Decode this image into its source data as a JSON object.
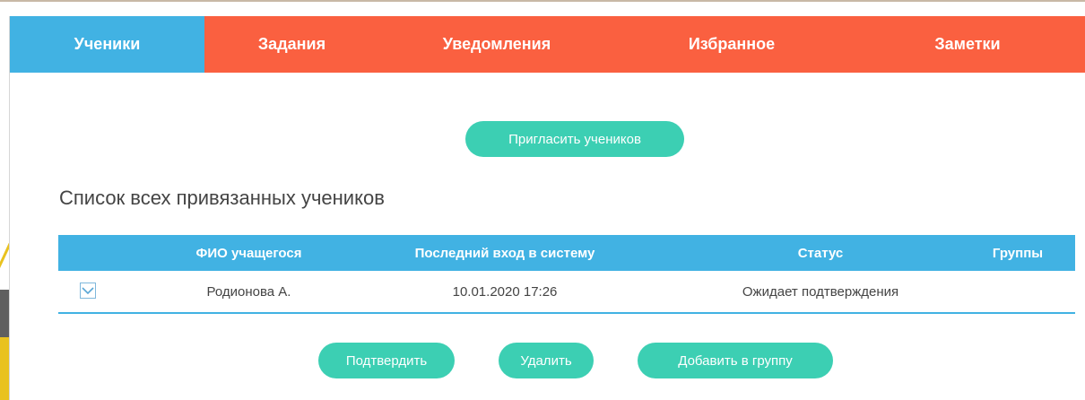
{
  "tabs": [
    {
      "label": "Ученики",
      "active": true
    },
    {
      "label": "Задания",
      "active": false
    },
    {
      "label": "Уведомления",
      "active": false
    },
    {
      "label": "Избранное",
      "active": false
    },
    {
      "label": "Заметки",
      "active": false
    }
  ],
  "invite_button": "Пригласить учеников",
  "section_title": "Список всех привязанных учеников",
  "table": {
    "headers": {
      "name": "ФИО учащегося",
      "last_login": "Последний вход в систему",
      "status": "Статус",
      "groups": "Группы"
    },
    "rows": [
      {
        "name": "Родионова А.",
        "last_login": "10.01.2020 17:26",
        "status": "Ожидает подтверждения",
        "groups": ""
      }
    ]
  },
  "actions": {
    "confirm": "Подтвердить",
    "delete": "Удалить",
    "add_to_group": "Добавить в группу"
  },
  "colors": {
    "tab_active": "#41b2e3",
    "tab_bar": "#fa6040",
    "button": "#3ccfb3",
    "table_header": "#41b2e3"
  },
  "icons": {
    "row_expand": "chevron-down-icon"
  }
}
